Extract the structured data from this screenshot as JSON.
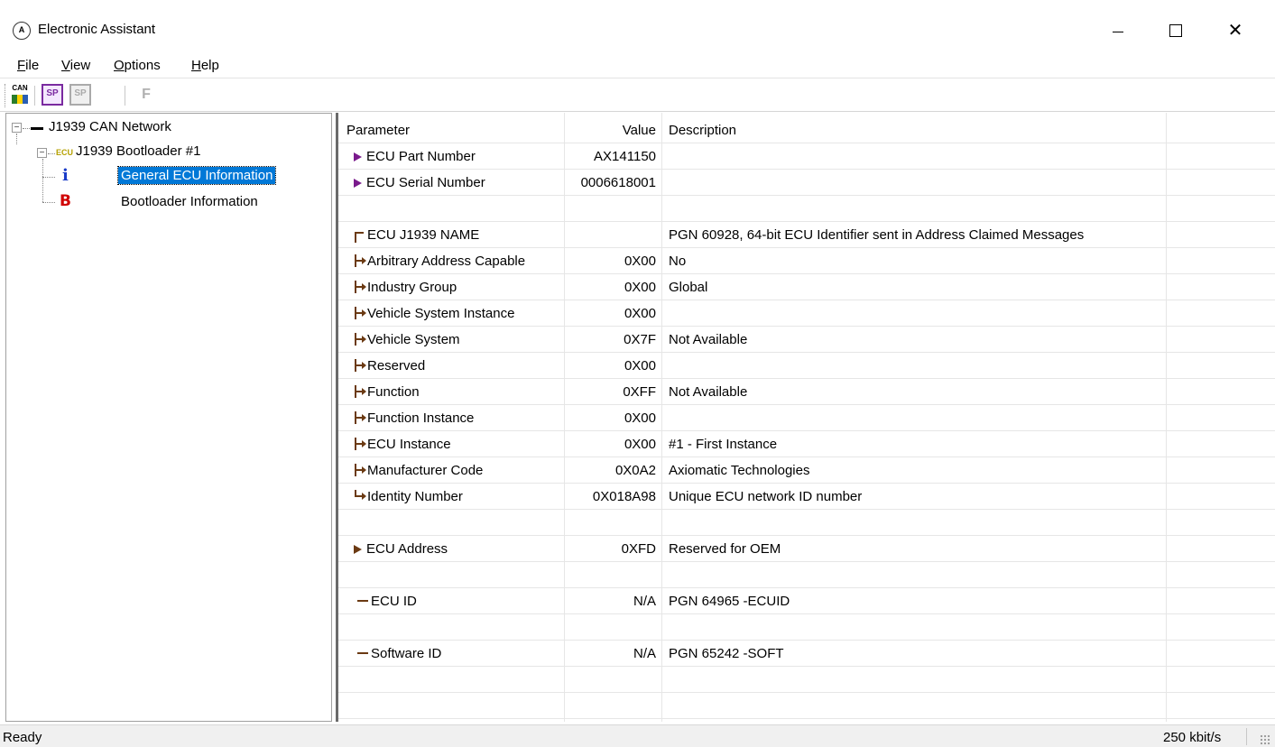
{
  "window": {
    "title": "Electronic Assistant",
    "app_icon_text": "A",
    "close_glyph": "✕"
  },
  "menu": [
    {
      "u": "F",
      "rest": "ile"
    },
    {
      "u": "V",
      "rest": "iew"
    },
    {
      "u": "O",
      "rest": "ptions"
    },
    {
      "u": "H",
      "rest": "elp"
    }
  ],
  "toolbar": {
    "can_label": "CAN",
    "sp_label": "SP",
    "f_label": "F"
  },
  "tree": {
    "network_expander": "−",
    "network": "J1939 CAN Network",
    "ecu_expander": "−",
    "ecu_tag": "ECU",
    "ecu": "J1939 Bootloader #1",
    "info_glyph": "i",
    "info": "General ECU Information",
    "boot_glyph": "B",
    "boot": "Bootloader Information"
  },
  "grid": {
    "headers": {
      "parameter": "Parameter",
      "value": "Value",
      "description": "Description"
    },
    "rows": [
      {
        "marker": "arrow",
        "parameter": "ECU Part Number",
        "value": "AX141150",
        "description": ""
      },
      {
        "marker": "arrow",
        "parameter": "ECU Serial Number",
        "value": "0006618001",
        "description": ""
      },
      {
        "marker": "none",
        "parameter": "",
        "value": "",
        "description": ""
      },
      {
        "marker": "first",
        "parameter": "ECU J1939 NAME",
        "value": "",
        "description": "PGN 60928, 64-bit ECU Identifier sent in Address Claimed Messages"
      },
      {
        "marker": "branch",
        "parameter": "Arbitrary Address Capable",
        "value": "0X00",
        "description": "No"
      },
      {
        "marker": "branch",
        "parameter": "Industry Group",
        "value": "0X00",
        "description": "Global"
      },
      {
        "marker": "branch",
        "parameter": "Vehicle System Instance",
        "value": "0X00",
        "description": ""
      },
      {
        "marker": "branch",
        "parameter": "Vehicle System",
        "value": "0X7F",
        "description": "Not Available"
      },
      {
        "marker": "branch",
        "parameter": "Reserved",
        "value": "0X00",
        "description": ""
      },
      {
        "marker": "branch",
        "parameter": "Function",
        "value": "0XFF",
        "description": "Not Available"
      },
      {
        "marker": "branch",
        "parameter": "Function Instance",
        "value": "0X00",
        "description": ""
      },
      {
        "marker": "branch",
        "parameter": "ECU Instance",
        "value": "0X00",
        "description": "#1 - First Instance"
      },
      {
        "marker": "branch",
        "parameter": "Manufacturer Code",
        "value": "0X0A2",
        "description": "Axiomatic Technologies"
      },
      {
        "marker": "last",
        "parameter": "Identity Number",
        "value": "0X018A98",
        "description": "Unique ECU network ID number"
      },
      {
        "marker": "none",
        "parameter": "",
        "value": "",
        "description": ""
      },
      {
        "marker": "arrow-brown",
        "parameter": "ECU Address",
        "value": "0XFD",
        "description": "Reserved for OEM"
      },
      {
        "marker": "none",
        "parameter": "",
        "value": "",
        "description": ""
      },
      {
        "marker": "dash",
        "parameter": "ECU ID",
        "value": "N/A",
        "description": "PGN 64965  -ECUID"
      },
      {
        "marker": "none",
        "parameter": "",
        "value": "",
        "description": ""
      },
      {
        "marker": "dash",
        "parameter": "Software ID",
        "value": "N/A",
        "description": "PGN 65242  -SOFT"
      },
      {
        "marker": "none",
        "parameter": "",
        "value": "",
        "description": ""
      },
      {
        "marker": "none",
        "parameter": "",
        "value": "",
        "description": ""
      }
    ]
  },
  "status": {
    "left": "Ready",
    "right": "250 kbit/s"
  }
}
